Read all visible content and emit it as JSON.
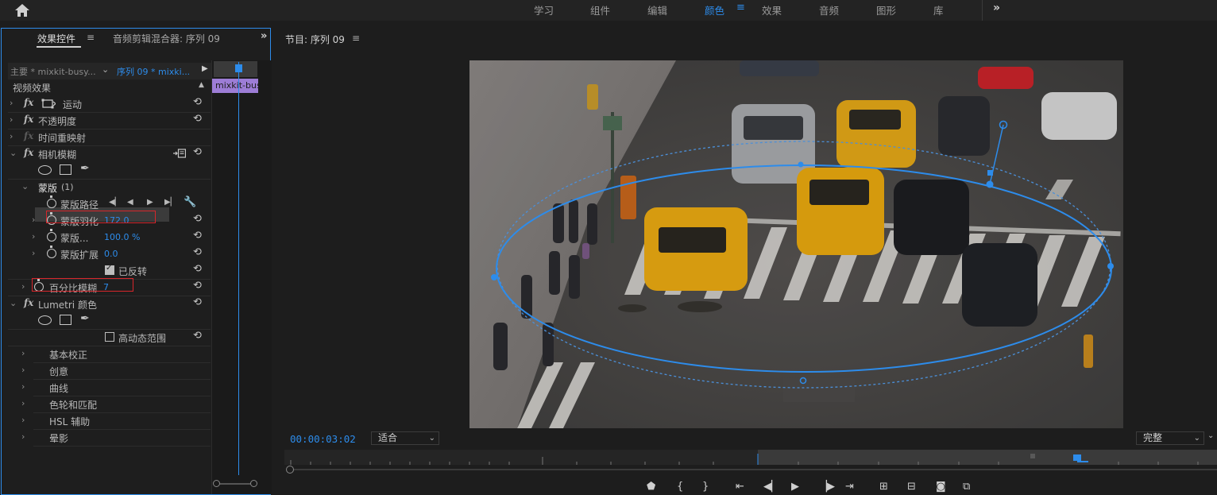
{
  "workspace_tabs": [
    {
      "label": "学习",
      "active": false
    },
    {
      "label": "组件",
      "active": false
    },
    {
      "label": "编辑",
      "active": false
    },
    {
      "label": "颜色",
      "active": true
    },
    {
      "label": "效果",
      "active": false
    },
    {
      "label": "音频",
      "active": false
    },
    {
      "label": "图形",
      "active": false
    },
    {
      "label": "库",
      "active": false
    }
  ],
  "effect_panel": {
    "tab_effects": "效果控件",
    "tab_mixer": "音频剪辑混合器: 序列 09",
    "master_clip": "主要 * mixkit-busy...",
    "sequence_clip": "序列 09 * mixki...",
    "section_label": "视频效果",
    "timeline_clip_label": "mixkit-bus",
    "effects": {
      "motion": "运动",
      "opacity": "不透明度",
      "time_remap": "时间重映射",
      "camera_blur": "相机模糊",
      "mask": "蒙版",
      "mask_count": "(1)",
      "mask_path": "蒙版路径",
      "mask_feather": "蒙版羽化",
      "mask_feather_value": "172.0",
      "mask_opacity": "蒙版...",
      "mask_opacity_value": "100.0 %",
      "mask_expansion": "蒙版扩展",
      "mask_expansion_value": "0.0",
      "inverted": "已反转",
      "percent_blur": "百分比模糊",
      "percent_blur_value": "7",
      "lumetri": "Lumetri 颜色",
      "hdr": "高动态范围",
      "basic_correction": "基本校正",
      "creative": "创意",
      "curves": "曲线",
      "color_wheels": "色轮和匹配",
      "hsl": "HSL 辅助",
      "vignette": "晕影"
    }
  },
  "program_monitor": {
    "title": "节目: 序列 09",
    "timecode": "00:00:03:02",
    "fit": "适合",
    "quality": "完整"
  },
  "colors": {
    "accent": "#2d8ceb",
    "highlight_box": "#d7262b",
    "clip_purple": "#9d7dd6"
  }
}
